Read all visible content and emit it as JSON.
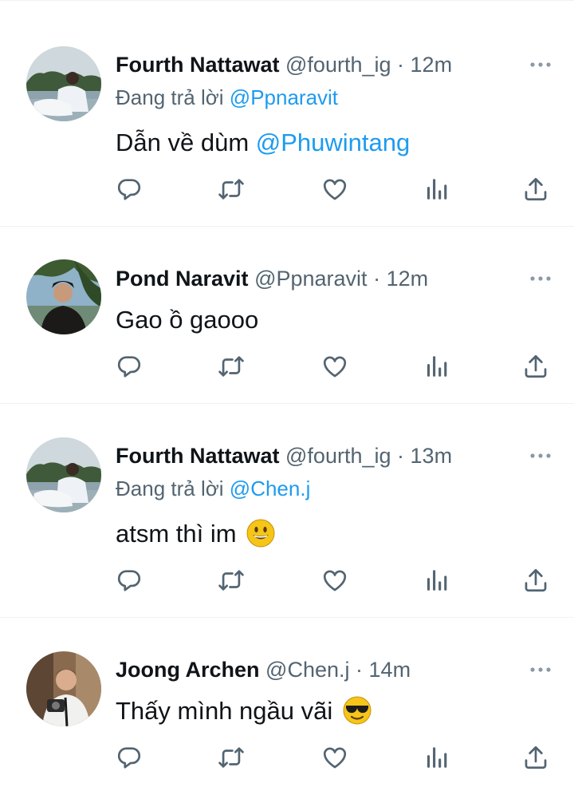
{
  "tweets": [
    {
      "name": "Fourth Nattawat",
      "handle": "@fourth_ig",
      "separator": "·",
      "time": "12m",
      "reply_prefix": "Đang trả lời",
      "reply_to": "@Ppnaravit",
      "text": "Dẫn về dùm",
      "text_mention": "@Phuwintang",
      "avatar": "avatar-fourth",
      "emoji": ""
    },
    {
      "name": "Pond Naravit",
      "handle": "@Ppnaravit",
      "separator": "·",
      "time": "12m",
      "text": "Gao ồ gaooo",
      "avatar": "avatar-pond",
      "emoji": ""
    },
    {
      "name": "Fourth Nattawat",
      "handle": "@fourth_ig",
      "separator": "·",
      "time": "13m",
      "reply_prefix": "Đang trả lời",
      "reply_to": "@Chen.j",
      "text": "atsm thì im",
      "avatar": "avatar-fourth",
      "emoji": "grinning-face"
    },
    {
      "name": "Joong Archen",
      "handle": "@Chen.j",
      "separator": "·",
      "time": "14m",
      "text": "Thấy mình ngầu vãi",
      "avatar": "avatar-joong",
      "emoji": "sunglasses-face"
    }
  ],
  "icons": [
    "more-icon",
    "reply-icon",
    "retweet-icon",
    "like-icon",
    "views-icon",
    "share-icon"
  ],
  "colors": {
    "text": "#0f1419",
    "secondary": "#536471",
    "link": "#1d9bf0",
    "divider": "#eff3f4"
  }
}
